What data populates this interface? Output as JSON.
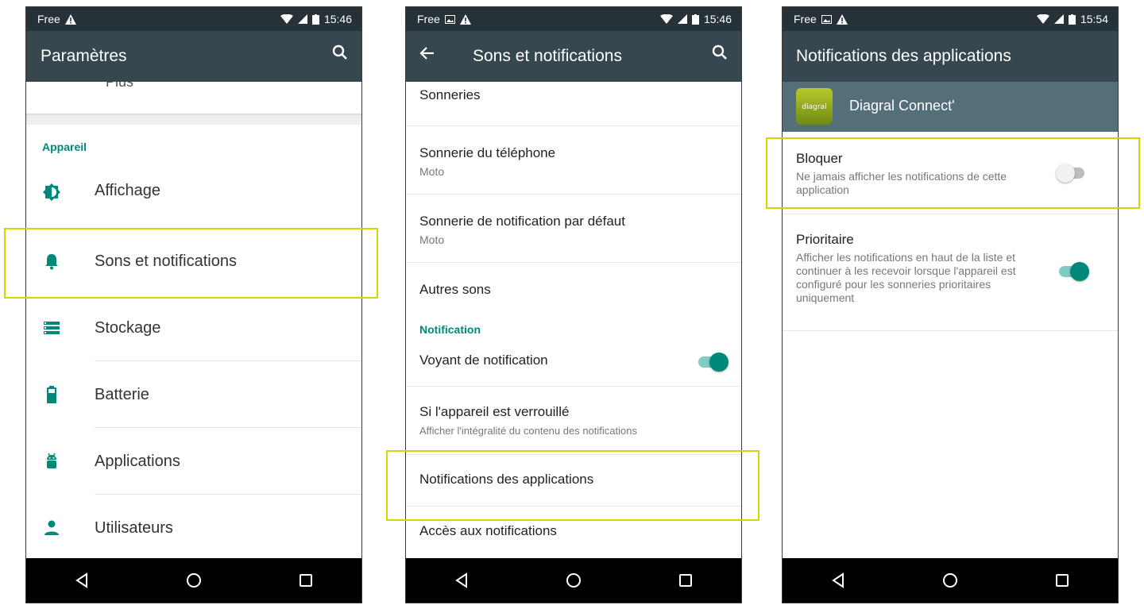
{
  "colors": {
    "statusbar": "#263238",
    "appbar": "#37474f",
    "accent": "#00897b",
    "highlight": "#d4d600",
    "navbar": "#000000"
  },
  "phone1": {
    "status": {
      "carrier": "Free",
      "time": "15:46"
    },
    "appbar": {
      "title": "Paramètres"
    },
    "ghost_item": "Plus",
    "section": "Appareil",
    "items": [
      {
        "label": "Affichage",
        "icon": "brightness-icon"
      },
      {
        "label": "Sons et notifications",
        "icon": "bell-icon"
      },
      {
        "label": "Stockage",
        "icon": "storage-icon"
      },
      {
        "label": "Batterie",
        "icon": "battery-icon"
      },
      {
        "label": "Applications",
        "icon": "android-icon"
      },
      {
        "label": "Utilisateurs",
        "icon": "person-icon"
      }
    ]
  },
  "phone2": {
    "status": {
      "carrier": "Free",
      "time": "15:46"
    },
    "appbar": {
      "title": "Sons et notifications"
    },
    "rows": [
      {
        "title": "Sonneries"
      },
      {
        "title": "Sonnerie du téléphone",
        "sub": "Moto"
      },
      {
        "title": "Sonnerie de notification par défaut",
        "sub": "Moto"
      },
      {
        "title": "Autres sons"
      }
    ],
    "section": "Notification",
    "notif_light": {
      "title": "Voyant de notification",
      "on": true
    },
    "locked": {
      "title": "Si l'appareil est verrouillé",
      "sub": "Afficher l'intégralité du contenu des notifications"
    },
    "app_notifs": {
      "title": "Notifications des applications"
    },
    "access": {
      "title": "Accès aux notifications"
    }
  },
  "phone3": {
    "status": {
      "carrier": "Free",
      "time": "15:54"
    },
    "appbar": {
      "title": "Notifications des applications"
    },
    "app": {
      "name": "Diagral Connect'",
      "logo_text": "diagral"
    },
    "block": {
      "title": "Bloquer",
      "sub": "Ne jamais afficher les notifications de cette application",
      "on": false
    },
    "priority": {
      "title": "Prioritaire",
      "sub": "Afficher les notifications en haut de la liste et continuer à les recevoir lorsque l'appareil est configuré pour les sonneries prioritaires uniquement",
      "on": true
    }
  }
}
